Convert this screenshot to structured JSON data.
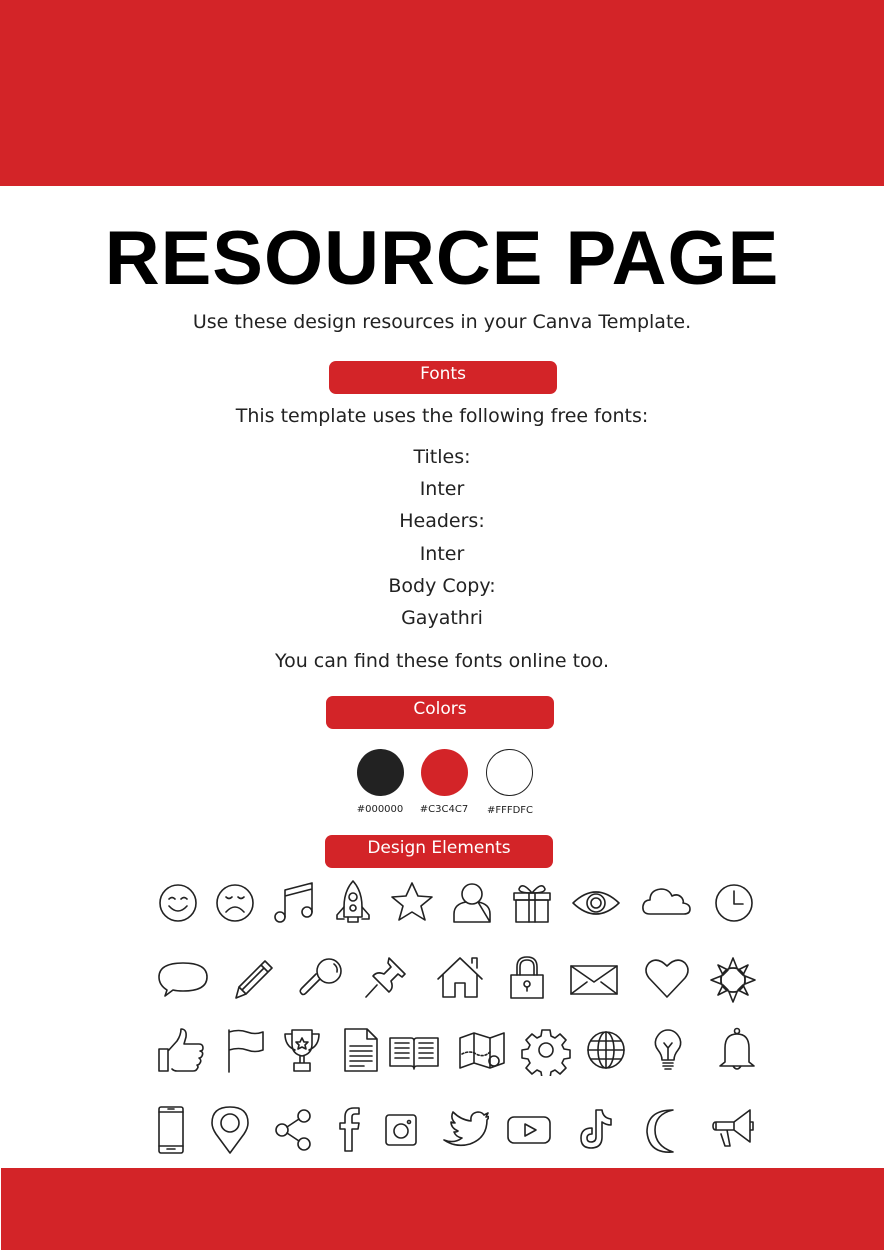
{
  "page": {
    "title": "RESOURCE PAGE",
    "subtitle": "Use these design resources in your Canva Template.",
    "accent_color": "#d32428"
  },
  "fonts_section": {
    "label": "Fonts",
    "intro": "This template uses the following free fonts:",
    "lines": [
      "Titles:",
      "Inter",
      "Headers:",
      "Inter",
      "Body Copy:",
      "Gayathri"
    ],
    "outro": "You can find these fonts online too."
  },
  "colors_section": {
    "label": "Colors",
    "swatches": [
      {
        "hex_label": "#000000",
        "color": "#222222"
      },
      {
        "hex_label": "#C3C4C7",
        "color": "#d32428"
      },
      {
        "hex_label": "#FFFDFC",
        "color": "#ffffff"
      }
    ]
  },
  "design_elements_section": {
    "label": "Design Elements",
    "icons": [
      [
        "smiley-face",
        "sad-face",
        "music-note",
        "rocket",
        "star",
        "user",
        "gift",
        "eye",
        "cloud",
        "clock"
      ],
      [
        "speech-bubble",
        "pencil",
        "magnifying-glass",
        "push-pin",
        "house",
        "padlock",
        "envelope",
        "heart",
        "sun"
      ],
      [
        "thumbs-up",
        "flag",
        "trophy",
        "document",
        "open-book",
        "map",
        "gear",
        "globe",
        "light-bulb",
        "bell"
      ],
      [
        "smartphone",
        "location-pin",
        "share",
        "facebook",
        "instagram",
        "twitter",
        "youtube",
        "tiktok",
        "crescent-moon",
        "megaphone"
      ]
    ]
  }
}
